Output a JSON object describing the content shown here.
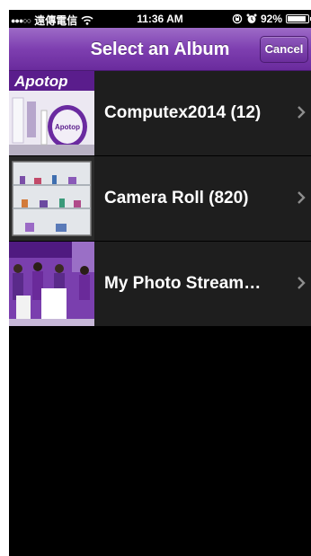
{
  "status_bar": {
    "signal": "●●●○○",
    "carrier": "遠傳電信",
    "time": "11:36 AM",
    "battery_text": "92%",
    "battery_level": 0.92
  },
  "nav": {
    "title": "Select an Album",
    "cancel_label": "Cancel"
  },
  "albums": [
    {
      "label": "Computex2014 (12)"
    },
    {
      "label": "Camera Roll (820)"
    },
    {
      "label": "My Photo Stream…"
    }
  ],
  "thumb_text": {
    "banner": "Apotop",
    "sign": "Apotop"
  },
  "colors": {
    "nav_purple": "#7e3fb0",
    "row_bg": "#1e1e1e",
    "screen_bg": "#000000"
  }
}
